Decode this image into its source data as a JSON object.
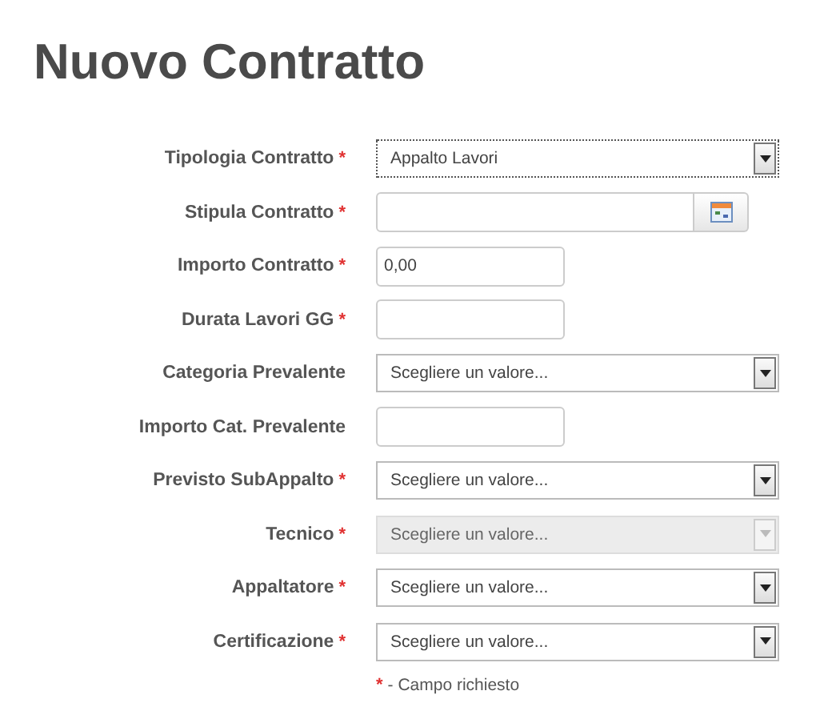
{
  "title": "Nuovo Contratto",
  "required_mark": "*",
  "fields": [
    {
      "label": "Tipologia Contratto",
      "required": true,
      "kind": "select",
      "value": "Appalto Lavori",
      "disabled": false,
      "focused": true
    },
    {
      "label": "Stipula Contratto",
      "required": true,
      "kind": "date"
    },
    {
      "label": "Importo Contratto",
      "required": true,
      "kind": "text",
      "value": "0,00"
    },
    {
      "label": "Durata Lavori GG",
      "required": true,
      "kind": "text"
    },
    {
      "label": "Categoria Prevalente",
      "required": false,
      "kind": "select",
      "value": "Scegliere un valore...",
      "disabled": false,
      "focused": false
    },
    {
      "label": "Importo Cat. Prevalente",
      "required": false,
      "kind": "text"
    },
    {
      "label": "Previsto SubAppalto",
      "required": true,
      "kind": "select",
      "value": "Scegliere un valore...",
      "disabled": false,
      "focused": false
    },
    {
      "label": "Tecnico",
      "required": true,
      "kind": "select",
      "value": "Scegliere un valore...",
      "disabled": true,
      "focused": false
    },
    {
      "label": "Appaltatore",
      "required": true,
      "kind": "select",
      "value": "Scegliere un valore...",
      "disabled": false,
      "focused": false
    },
    {
      "label": "Certificazione",
      "required": true,
      "kind": "select",
      "value": "Scegliere un valore...",
      "disabled": false,
      "focused": false
    }
  ],
  "note": "- Campo richiesto"
}
